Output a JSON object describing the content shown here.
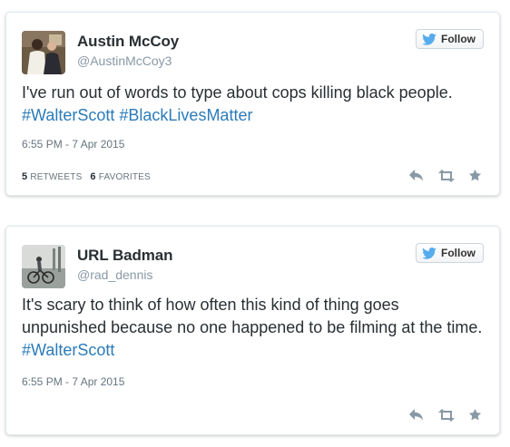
{
  "follow_label": "Follow",
  "colors": {
    "hashtag": "#2b7bb9",
    "name": "#292f33",
    "muted": "#8899a6",
    "twitter_blue": "#55acee"
  },
  "icons": {
    "follow": "twitter-bird-icon",
    "reply": "reply-icon",
    "retweet": "retweet-icon",
    "favorite": "star-icon"
  },
  "tweets": [
    {
      "name": "Austin McCoy",
      "handle": "@AustinMcCoy3",
      "text_plain": "I've run out of words to type about cops killing black people. ",
      "hashtags": [
        "#WalterScott",
        "#BlackLivesMatter"
      ],
      "timestamp": "6:55 PM - 7 Apr 2015",
      "retweets_count": "5",
      "retweets_label": "RETWEETS",
      "favorites_count": "6",
      "favorites_label": "FAVORITES"
    },
    {
      "name": "URL Badman",
      "handle": "@rad_dennis",
      "text_plain": "It's scary to think of how often this kind of thing goes unpunished because no one happened to be filming at the time. ",
      "hashtags": [
        "#WalterScott"
      ],
      "timestamp": "6:55 PM - 7 Apr 2015"
    }
  ]
}
